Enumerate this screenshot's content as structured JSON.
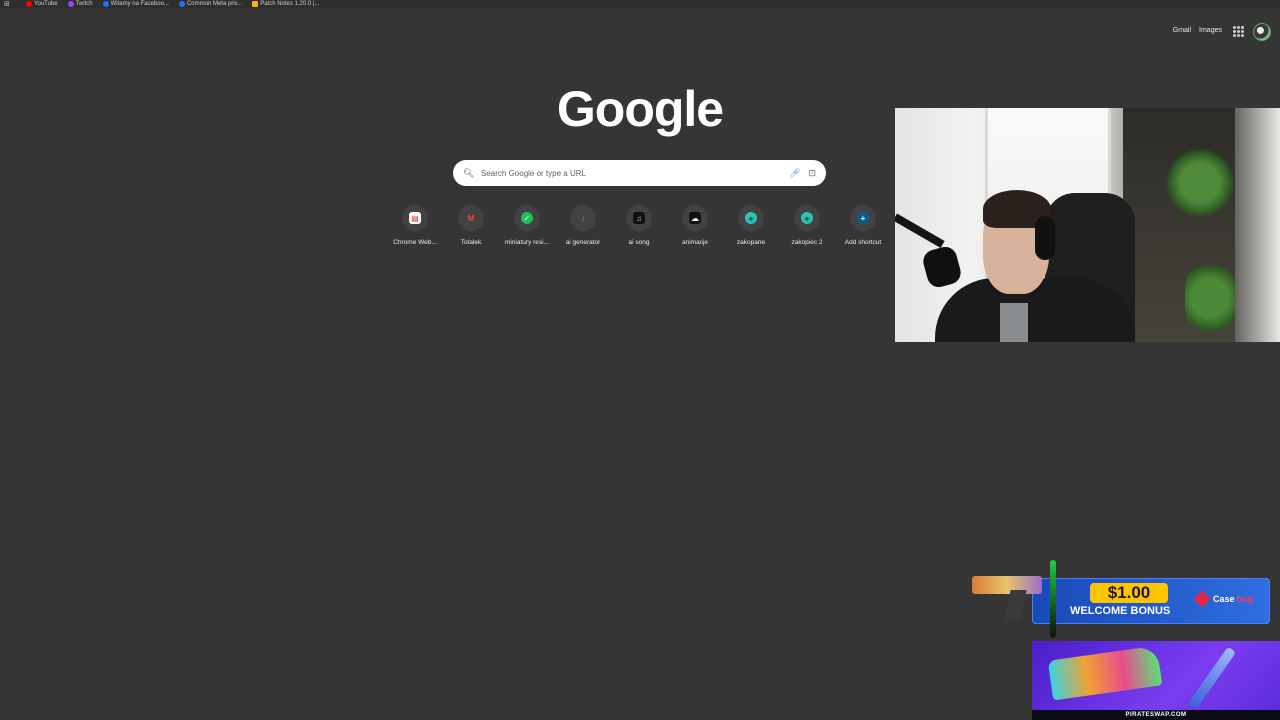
{
  "bookmarks": [
    {
      "label": "YouTube",
      "color": "#ff0000"
    },
    {
      "label": "Twitch",
      "color": "#9146ff"
    },
    {
      "label": "Witamy na Faceboo...",
      "color": "#1877f2"
    },
    {
      "label": "Common Meta priv...",
      "color": "#1877f2"
    },
    {
      "label": "Patch Notes 1.20.0 |...",
      "color": "#f2b705"
    }
  ],
  "header": {
    "gmail_label": "Gmail",
    "images_label": "Images"
  },
  "logo": {
    "text": "Google"
  },
  "search": {
    "placeholder": "Search Google or type a URL"
  },
  "shortcuts": [
    {
      "label": "Chrome Web...",
      "icon": "chrome-web-store-icon",
      "glyph": "▤",
      "bg": "#ffffff",
      "fg": "#d93025"
    },
    {
      "label": "Totalek",
      "icon": "gmail-icon",
      "glyph": "M",
      "bg": "transparent",
      "fg": "#ea4335"
    },
    {
      "label": "miniatury resi...",
      "icon": "checkmark-icon",
      "glyph": "✓",
      "bg": "#1fbf5a",
      "fg": "#ffffff"
    },
    {
      "label": "ai generator",
      "icon": "music-note-icon",
      "glyph": "♪",
      "bg": "transparent",
      "fg": "#c06a8a"
    },
    {
      "label": "ai song",
      "icon": "music-app-icon",
      "glyph": "♫",
      "bg": "#111111",
      "fg": "#6bff5e"
    },
    {
      "label": "animacje",
      "icon": "cloud-icon",
      "glyph": "☁",
      "bg": "#111111",
      "fg": "#ffffff"
    },
    {
      "label": "zakopane",
      "icon": "cam-icon",
      "glyph": "●",
      "bg": "#27c4b4",
      "fg": "#0d3d38"
    },
    {
      "label": "zakopiec 2",
      "icon": "cam-icon",
      "glyph": "●",
      "bg": "#27c4b4",
      "fg": "#0d3d38"
    },
    {
      "label": "Add shortcut",
      "icon": "plus-icon",
      "glyph": "+",
      "bg": "#0a5e8c",
      "fg": "#ffffff"
    }
  ],
  "promo_casehug": {
    "amount": "$1.00",
    "headline": "WELCOME BONUS",
    "brand_main": "Case",
    "brand_accent": "hug"
  },
  "promo_pirateswap": {
    "domain": "PIRATESWAP.COM"
  },
  "colors": {
    "background": "#353535",
    "search_bg": "#ffffff",
    "promo_blue": "#1a49b8",
    "promo_yellow": "#ffc400",
    "promo_purple": "#7a3df0"
  }
}
